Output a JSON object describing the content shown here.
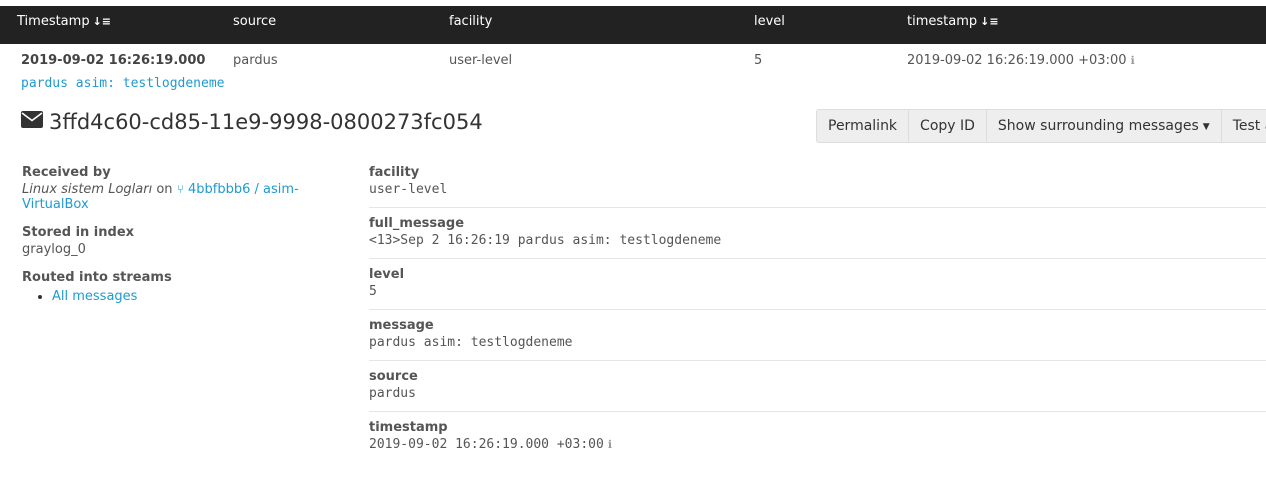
{
  "table": {
    "columns": [
      {
        "label": "Timestamp",
        "sort_icon": "sort-desc-icon"
      },
      {
        "label": "source"
      },
      {
        "label": "facility"
      },
      {
        "label": "level"
      },
      {
        "label": "timestamp",
        "sort_icon": "sort-desc-icon"
      }
    ],
    "row": {
      "timestamp": "2019-09-02 16:26:19.000",
      "source": "pardus",
      "facility": "user-level",
      "level": "5",
      "timestamp_field": "2019-09-02 16:26:19.000 +03:00"
    },
    "message_line": "pardus asim: testlogdeneme"
  },
  "detail": {
    "message_id": "3ffd4c60-cd85-11e9-9998-0800273fc054",
    "buttons": {
      "permalink": "Permalink",
      "copy_id": "Copy ID",
      "surrounding": "Show surrounding messages",
      "test": "Test a"
    },
    "received_by": {
      "label": "Received by",
      "input_name": "Linux sistem Logları",
      "on": "on",
      "node": "4bbfbbb6 / asim-VirtualBox"
    },
    "stored_in_index": {
      "label": "Stored in index",
      "value": "graylog_0"
    },
    "routed_into_streams": {
      "label": "Routed into streams",
      "streams": [
        "All messages"
      ]
    },
    "fields": [
      {
        "name": "facility",
        "value": "user-level"
      },
      {
        "name": "full_message",
        "value": "<13>Sep  2 16:26:19 pardus asim: testlogdeneme"
      },
      {
        "name": "level",
        "value": "5"
      },
      {
        "name": "message",
        "value": "pardus asim: testlogdeneme"
      },
      {
        "name": "source",
        "value": "pardus"
      },
      {
        "name": "timestamp",
        "value": "2019-09-02 16:26:19.000 +03:00"
      }
    ]
  },
  "colors": {
    "header_bg": "#222222",
    "link": "#1f9bcf"
  }
}
